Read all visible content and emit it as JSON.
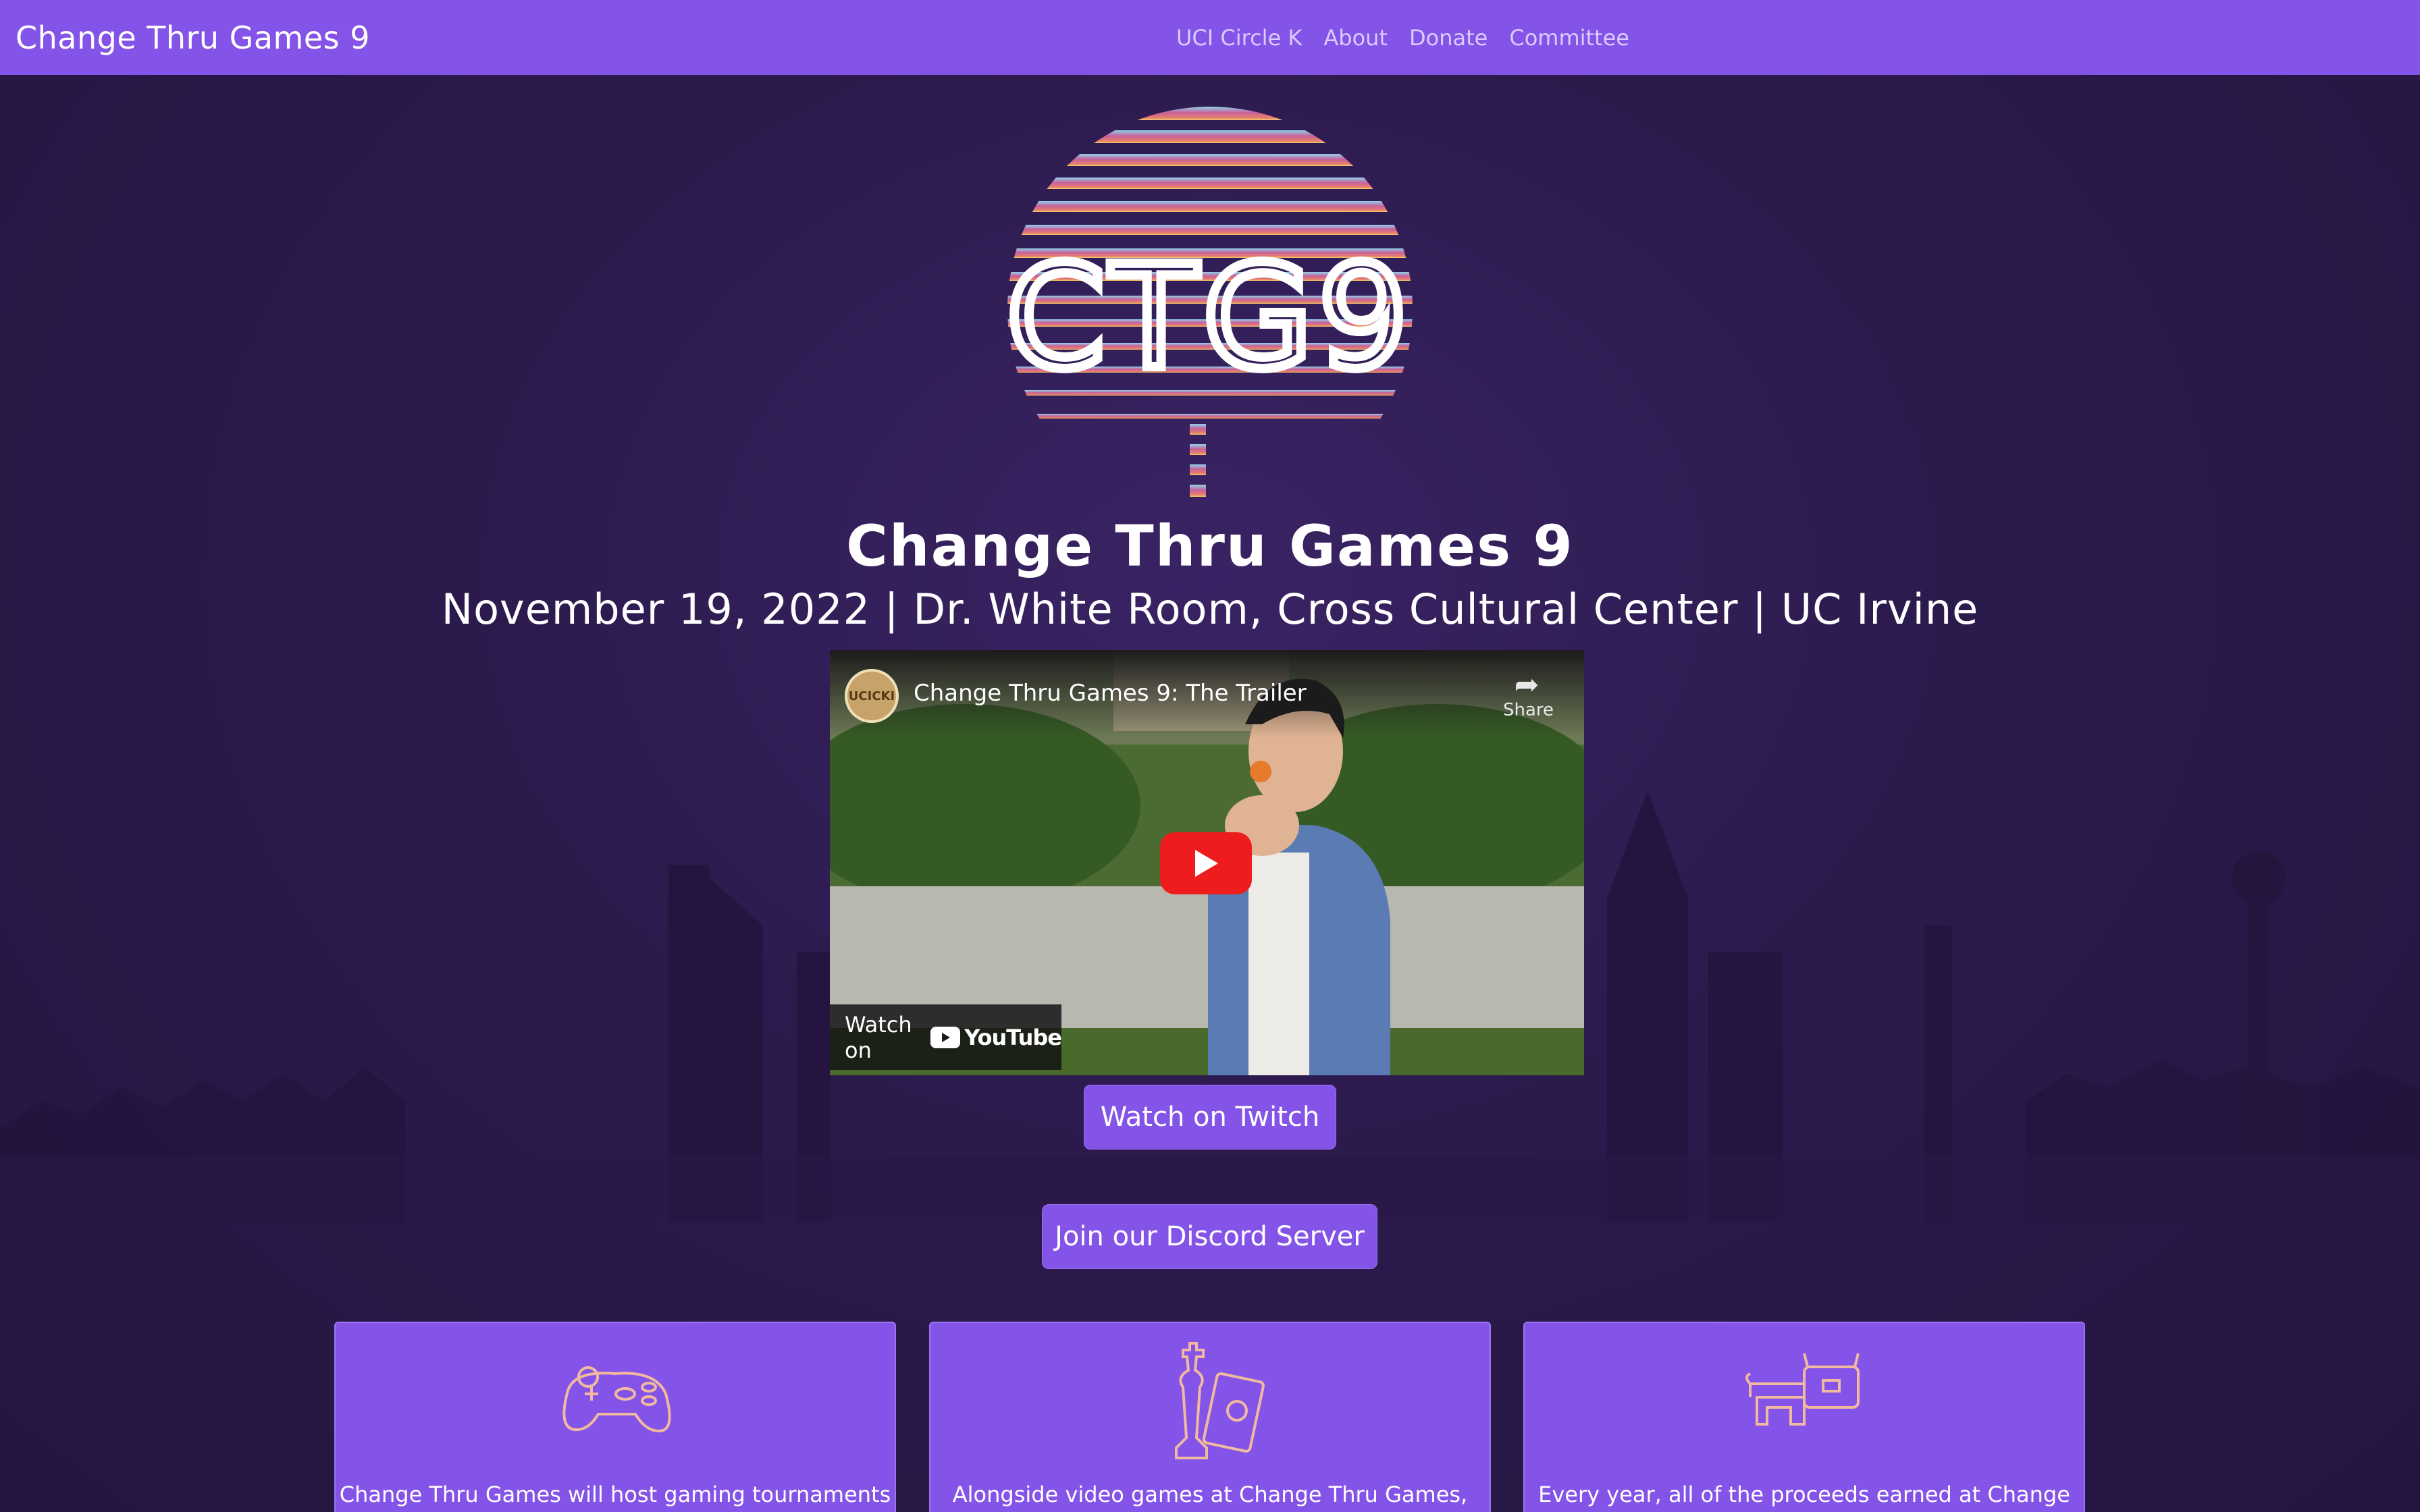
{
  "navbar": {
    "brand": "Change Thru Games 9",
    "links": [
      "UCI Circle K",
      "About",
      "Donate",
      "Committee"
    ]
  },
  "hero": {
    "logo_text": "CTG9",
    "title": "Change Thru Games 9",
    "subtitle": "November 19, 2022 | Dr. White Room, Cross Cultural Center | UC Irvine"
  },
  "video": {
    "channel_badge": "UCICKI",
    "title": "Change Thru Games 9: The Trailer",
    "share_label": "Share",
    "watch_on_label": "Watch on",
    "youtube_label": "YouTube"
  },
  "buttons": {
    "twitch": "Watch on Twitch",
    "discord": "Join our Discord Server"
  },
  "cards": [
    {
      "icon": "game-controller-icon",
      "text": "Change Thru Games will host gaming tournaments"
    },
    {
      "icon": "chess-cards-icon",
      "text": "Alongside video games at Change Thru Games,"
    },
    {
      "icon": "piggy-bank-icon",
      "text": "Every year, all of the proceeds earned at Change"
    }
  ],
  "colors": {
    "accent": "#8454e8",
    "background": "#2a1848",
    "nav_link": "#d9cbff",
    "logo_gradient_top": "#8fd3ec",
    "logo_gradient_mid": "#c8609a",
    "logo_gradient_bottom": "#f3d26b"
  }
}
